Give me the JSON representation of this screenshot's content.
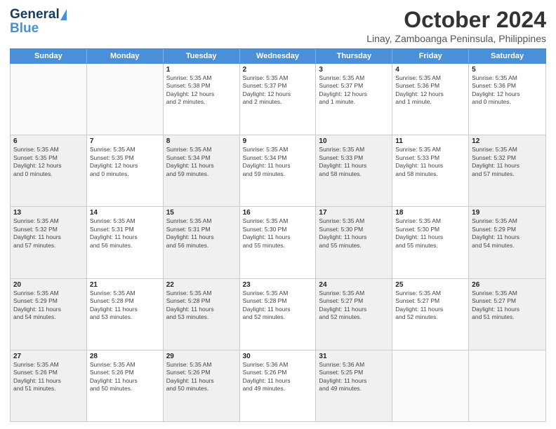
{
  "header": {
    "logo_general": "General",
    "logo_blue": "Blue",
    "month_title": "October 2024",
    "subtitle": "Linay, Zamboanga Peninsula, Philippines"
  },
  "weekdays": [
    "Sunday",
    "Monday",
    "Tuesday",
    "Wednesday",
    "Thursday",
    "Friday",
    "Saturday"
  ],
  "rows": [
    [
      {
        "day": "",
        "lines": [],
        "shaded": false,
        "empty": true
      },
      {
        "day": "",
        "lines": [],
        "shaded": false,
        "empty": true
      },
      {
        "day": "1",
        "lines": [
          "Sunrise: 5:35 AM",
          "Sunset: 5:38 PM",
          "Daylight: 12 hours",
          "and 2 minutes."
        ],
        "shaded": false,
        "empty": false
      },
      {
        "day": "2",
        "lines": [
          "Sunrise: 5:35 AM",
          "Sunset: 5:37 PM",
          "Daylight: 12 hours",
          "and 2 minutes."
        ],
        "shaded": false,
        "empty": false
      },
      {
        "day": "3",
        "lines": [
          "Sunrise: 5:35 AM",
          "Sunset: 5:37 PM",
          "Daylight: 12 hours",
          "and 1 minute."
        ],
        "shaded": false,
        "empty": false
      },
      {
        "day": "4",
        "lines": [
          "Sunrise: 5:35 AM",
          "Sunset: 5:36 PM",
          "Daylight: 12 hours",
          "and 1 minute."
        ],
        "shaded": false,
        "empty": false
      },
      {
        "day": "5",
        "lines": [
          "Sunrise: 5:35 AM",
          "Sunset: 5:36 PM",
          "Daylight: 12 hours",
          "and 0 minutes."
        ],
        "shaded": false,
        "empty": false
      }
    ],
    [
      {
        "day": "6",
        "lines": [
          "Sunrise: 5:35 AM",
          "Sunset: 5:35 PM",
          "Daylight: 12 hours",
          "and 0 minutes."
        ],
        "shaded": true,
        "empty": false
      },
      {
        "day": "7",
        "lines": [
          "Sunrise: 5:35 AM",
          "Sunset: 5:35 PM",
          "Daylight: 12 hours",
          "and 0 minutes."
        ],
        "shaded": false,
        "empty": false
      },
      {
        "day": "8",
        "lines": [
          "Sunrise: 5:35 AM",
          "Sunset: 5:34 PM",
          "Daylight: 11 hours",
          "and 59 minutes."
        ],
        "shaded": true,
        "empty": false
      },
      {
        "day": "9",
        "lines": [
          "Sunrise: 5:35 AM",
          "Sunset: 5:34 PM",
          "Daylight: 11 hours",
          "and 59 minutes."
        ],
        "shaded": false,
        "empty": false
      },
      {
        "day": "10",
        "lines": [
          "Sunrise: 5:35 AM",
          "Sunset: 5:33 PM",
          "Daylight: 11 hours",
          "and 58 minutes."
        ],
        "shaded": true,
        "empty": false
      },
      {
        "day": "11",
        "lines": [
          "Sunrise: 5:35 AM",
          "Sunset: 5:33 PM",
          "Daylight: 11 hours",
          "and 58 minutes."
        ],
        "shaded": false,
        "empty": false
      },
      {
        "day": "12",
        "lines": [
          "Sunrise: 5:35 AM",
          "Sunset: 5:32 PM",
          "Daylight: 11 hours",
          "and 57 minutes."
        ],
        "shaded": true,
        "empty": false
      }
    ],
    [
      {
        "day": "13",
        "lines": [
          "Sunrise: 5:35 AM",
          "Sunset: 5:32 PM",
          "Daylight: 11 hours",
          "and 57 minutes."
        ],
        "shaded": true,
        "empty": false
      },
      {
        "day": "14",
        "lines": [
          "Sunrise: 5:35 AM",
          "Sunset: 5:31 PM",
          "Daylight: 11 hours",
          "and 56 minutes."
        ],
        "shaded": false,
        "empty": false
      },
      {
        "day": "15",
        "lines": [
          "Sunrise: 5:35 AM",
          "Sunset: 5:31 PM",
          "Daylight: 11 hours",
          "and 56 minutes."
        ],
        "shaded": true,
        "empty": false
      },
      {
        "day": "16",
        "lines": [
          "Sunrise: 5:35 AM",
          "Sunset: 5:30 PM",
          "Daylight: 11 hours",
          "and 55 minutes."
        ],
        "shaded": false,
        "empty": false
      },
      {
        "day": "17",
        "lines": [
          "Sunrise: 5:35 AM",
          "Sunset: 5:30 PM",
          "Daylight: 11 hours",
          "and 55 minutes."
        ],
        "shaded": true,
        "empty": false
      },
      {
        "day": "18",
        "lines": [
          "Sunrise: 5:35 AM",
          "Sunset: 5:30 PM",
          "Daylight: 11 hours",
          "and 55 minutes."
        ],
        "shaded": false,
        "empty": false
      },
      {
        "day": "19",
        "lines": [
          "Sunrise: 5:35 AM",
          "Sunset: 5:29 PM",
          "Daylight: 11 hours",
          "and 54 minutes."
        ],
        "shaded": true,
        "empty": false
      }
    ],
    [
      {
        "day": "20",
        "lines": [
          "Sunrise: 5:35 AM",
          "Sunset: 5:29 PM",
          "Daylight: 11 hours",
          "and 54 minutes."
        ],
        "shaded": true,
        "empty": false
      },
      {
        "day": "21",
        "lines": [
          "Sunrise: 5:35 AM",
          "Sunset: 5:28 PM",
          "Daylight: 11 hours",
          "and 53 minutes."
        ],
        "shaded": false,
        "empty": false
      },
      {
        "day": "22",
        "lines": [
          "Sunrise: 5:35 AM",
          "Sunset: 5:28 PM",
          "Daylight: 11 hours",
          "and 53 minutes."
        ],
        "shaded": true,
        "empty": false
      },
      {
        "day": "23",
        "lines": [
          "Sunrise: 5:35 AM",
          "Sunset: 5:28 PM",
          "Daylight: 11 hours",
          "and 52 minutes."
        ],
        "shaded": false,
        "empty": false
      },
      {
        "day": "24",
        "lines": [
          "Sunrise: 5:35 AM",
          "Sunset: 5:27 PM",
          "Daylight: 11 hours",
          "and 52 minutes."
        ],
        "shaded": true,
        "empty": false
      },
      {
        "day": "25",
        "lines": [
          "Sunrise: 5:35 AM",
          "Sunset: 5:27 PM",
          "Daylight: 11 hours",
          "and 52 minutes."
        ],
        "shaded": false,
        "empty": false
      },
      {
        "day": "26",
        "lines": [
          "Sunrise: 5:35 AM",
          "Sunset: 5:27 PM",
          "Daylight: 11 hours",
          "and 51 minutes."
        ],
        "shaded": true,
        "empty": false
      }
    ],
    [
      {
        "day": "27",
        "lines": [
          "Sunrise: 5:35 AM",
          "Sunset: 5:26 PM",
          "Daylight: 11 hours",
          "and 51 minutes."
        ],
        "shaded": true,
        "empty": false
      },
      {
        "day": "28",
        "lines": [
          "Sunrise: 5:35 AM",
          "Sunset: 5:26 PM",
          "Daylight: 11 hours",
          "and 50 minutes."
        ],
        "shaded": false,
        "empty": false
      },
      {
        "day": "29",
        "lines": [
          "Sunrise: 5:35 AM",
          "Sunset: 5:26 PM",
          "Daylight: 11 hours",
          "and 50 minutes."
        ],
        "shaded": true,
        "empty": false
      },
      {
        "day": "30",
        "lines": [
          "Sunrise: 5:36 AM",
          "Sunset: 5:26 PM",
          "Daylight: 11 hours",
          "and 49 minutes."
        ],
        "shaded": false,
        "empty": false
      },
      {
        "day": "31",
        "lines": [
          "Sunrise: 5:36 AM",
          "Sunset: 5:25 PM",
          "Daylight: 11 hours",
          "and 49 minutes."
        ],
        "shaded": true,
        "empty": false
      },
      {
        "day": "",
        "lines": [],
        "shaded": false,
        "empty": true
      },
      {
        "day": "",
        "lines": [],
        "shaded": false,
        "empty": true
      }
    ]
  ]
}
